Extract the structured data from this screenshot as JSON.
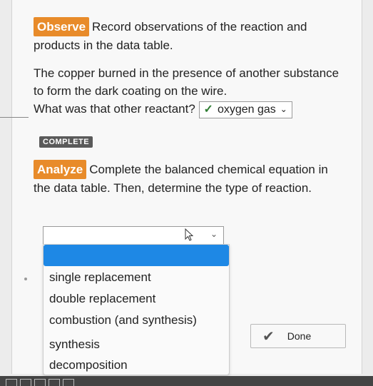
{
  "observe": {
    "tag": "Observe",
    "text": "Record observations of the reaction and products in the data table."
  },
  "question": {
    "line1": "The copper burned in the presence of another substance to form the dark coating on the wire.",
    "line2": "What was that other reactant?",
    "answer": "oxygen gas"
  },
  "status_badge": "COMPLETE",
  "analyze": {
    "tag": "Analyze",
    "text": "Complete the balanced chemical equation in the data table. Then, determine the type of reaction."
  },
  "dropdown": {
    "selected": "",
    "options": [
      "single replacement",
      "double replacement",
      "combustion (and synthesis)",
      "synthesis",
      "decomposition"
    ]
  },
  "done_button": {
    "label": "Done"
  },
  "colors": {
    "tag_orange": "#e88b2a",
    "highlight_blue": "#1e88e5",
    "check_green": "#2e7d32"
  }
}
